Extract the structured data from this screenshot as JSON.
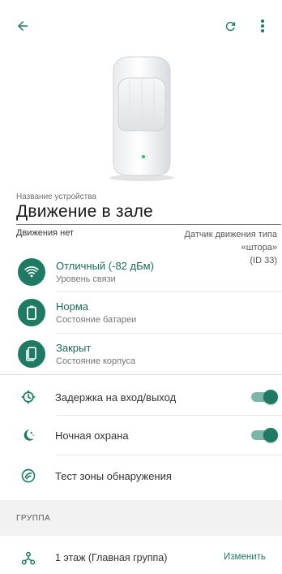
{
  "header": {
    "back_icon": "arrow-left-icon",
    "refresh_icon": "refresh-icon",
    "more_icon": "more-vertical-icon"
  },
  "device": {
    "name_label": "Название устройства",
    "name": "Движение в зале",
    "motion_status": "Движения нет",
    "type_line1": "Датчик движения типа",
    "type_line2": "«штора»",
    "type_line3": "(ID 33)"
  },
  "status": {
    "signal": {
      "icon": "wifi-icon",
      "title": "Отличный (-82 дБм)",
      "subtitle": "Уровень связи"
    },
    "battery": {
      "icon": "battery-icon",
      "title": "Норма",
      "subtitle": "Состояние батареи"
    },
    "case": {
      "icon": "tamper-case-icon",
      "title": "Закрыт",
      "subtitle": "Состояние корпуса"
    }
  },
  "settings": {
    "entry_delay": {
      "icon": "delay-timer-icon",
      "label": "Задержка на вход/выход",
      "enabled": true
    },
    "night_guard": {
      "icon": "moon-icon",
      "label": "Ночная охрана",
      "enabled": true
    },
    "zone_test": {
      "icon": "zone-test-icon",
      "label": "Тест зоны обнаружения"
    }
  },
  "group": {
    "header": "ГРУППА",
    "icon": "group-hierarchy-icon",
    "name": "1 этаж (Главная группа)",
    "change_label": "Изменить"
  },
  "colors": {
    "accent": "#1f7a63",
    "toggle_track": "#7bb6a6",
    "led": "#22c55e"
  }
}
